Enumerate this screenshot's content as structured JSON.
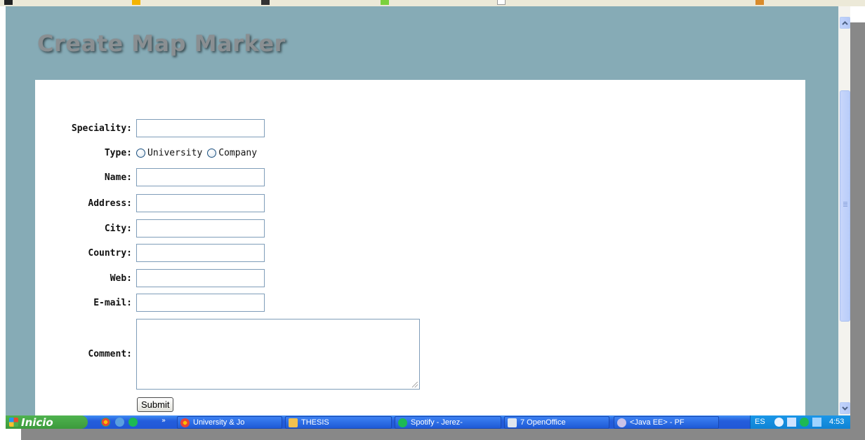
{
  "page": {
    "title": "Create Map Marker"
  },
  "form": {
    "fields": [
      {
        "label": "Speciality:",
        "value": ""
      },
      {
        "label": "Name:",
        "value": ""
      },
      {
        "label": "Address:",
        "value": ""
      },
      {
        "label": "City:",
        "value": ""
      },
      {
        "label": "Country:",
        "value": ""
      },
      {
        "label": "Web:",
        "value": ""
      },
      {
        "label": "E-mail:",
        "value": ""
      }
    ],
    "type_label": "Type:",
    "type_options": [
      "University",
      "Company"
    ],
    "comment_label": "Comment:",
    "comment_value": "",
    "submit_label": "Submit"
  },
  "taskbar": {
    "start_label": "Inicio",
    "items": [
      "University & Jo",
      "THESIS",
      "Spotify - Jerez-",
      "7 OpenOffice",
      "<Java EE> - PF"
    ],
    "language": "ES",
    "clock": "4:53"
  },
  "colors": {
    "page_background": "#86abb6",
    "title_text": "#8a8f92",
    "taskbar": "#245edc",
    "start_button": "#3c9a3c"
  }
}
